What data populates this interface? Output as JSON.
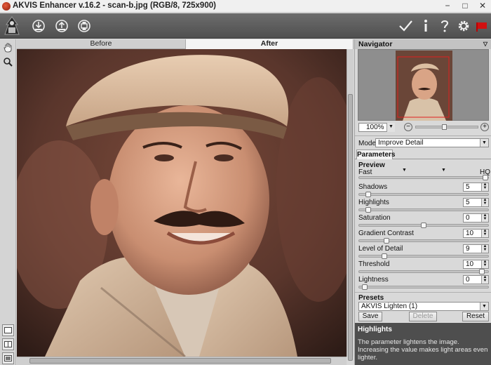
{
  "window": {
    "title": "AKVIS Enhancer v.16.2 - scan-b.jpg (RGB/8, 725x900)",
    "minimize": "−",
    "maximize": "□",
    "close": "✕"
  },
  "toolbar": {
    "icons": [
      "akvis-logo-icon",
      "open-icon",
      "save-icon",
      "print-icon",
      "apply-icon",
      "info-icon",
      "help-icon",
      "settings-icon",
      "flag-icon"
    ]
  },
  "view_tabs": {
    "before": "Before",
    "after": "After",
    "active": "After"
  },
  "navigator": {
    "title": "Navigator",
    "zoom": "100%",
    "zoom_minus": "−",
    "zoom_plus": "+",
    "zoom_level": 0.45
  },
  "mode": {
    "label": "Mode:",
    "value": "Improve Detail"
  },
  "parameters": {
    "tab": "Parameters",
    "preview_label": "Preview",
    "fast_label": "Fast",
    "hq_label": "HQ",
    "controls": [
      {
        "label": "Shadows",
        "value": "5",
        "level": 0.05
      },
      {
        "label": "Highlights",
        "value": "5",
        "level": 0.05
      },
      {
        "label": "Saturation",
        "value": "0",
        "level": 0.5
      },
      {
        "label": "Gradient Contrast",
        "value": "10",
        "level": 0.2
      },
      {
        "label": "Level of Detail",
        "value": "9",
        "level": 0.18
      },
      {
        "label": "Threshold",
        "value": "10",
        "level": 0.97
      },
      {
        "label": "Lightness",
        "value": "0",
        "level": 0.02
      }
    ]
  },
  "presets": {
    "title": "Presets",
    "selected": "AKVIS Lighten (1)",
    "save": "Save",
    "delete": "Delete",
    "reset": "Reset"
  },
  "help": {
    "title": "Highlights",
    "text": "The parameter lightens the image. Increasing the value makes light areas even lighter."
  },
  "colors": {
    "toolbar": "#5a5a5a",
    "panel": "#d9d9d9",
    "help_bg": "#4e4e4e",
    "flag": "#d01010"
  }
}
